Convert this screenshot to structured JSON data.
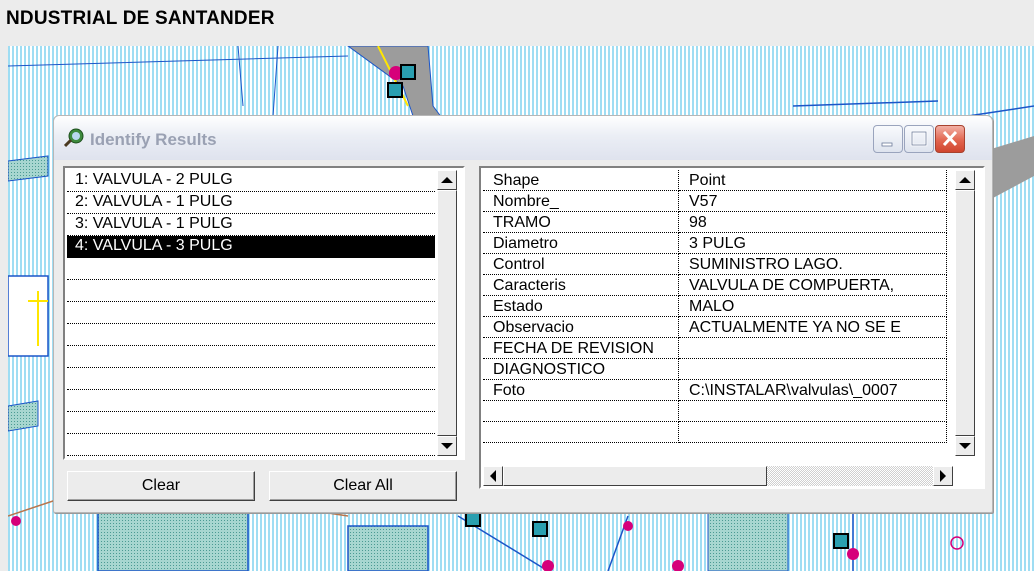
{
  "background": {
    "title": "NDUSTRIAL DE SANTANDER"
  },
  "dialog": {
    "title": "Identify Results",
    "icon": "identify-magnifier-globe-icon",
    "list_items": [
      {
        "label": "1:  VALVULA - 2 PULG",
        "selected": false
      },
      {
        "label": "2:  VALVULA - 1 PULG",
        "selected": false
      },
      {
        "label": "3:  VALVULA - 1 PULG",
        "selected": false
      },
      {
        "label": "4:  VALVULA - 3 PULG",
        "selected": true
      }
    ],
    "attributes": [
      {
        "field": "Shape",
        "value": "Point"
      },
      {
        "field": "Nombre_",
        "value": "V57"
      },
      {
        "field": "TRAMO",
        "value": "98"
      },
      {
        "field": "Diametro",
        "value": "3 PULG"
      },
      {
        "field": "Control",
        "value": "SUMINISTRO LAGO."
      },
      {
        "field": "Caracteris",
        "value": "VALVULA DE COMPUERTA,"
      },
      {
        "field": "Estado",
        "value": "MALO"
      },
      {
        "field": "Observacio",
        "value": "ACTUALMENTE YA NO SE E"
      },
      {
        "field": "FECHA DE REVISION",
        "value": ""
      },
      {
        "field": "DIAGNOSTICO",
        "value": ""
      },
      {
        "field": "Foto",
        "value": "C:\\INSTALAR\\valvulas\\_0007"
      },
      {
        "field": "",
        "value": ""
      },
      {
        "field": "",
        "value": ""
      }
    ],
    "buttons": {
      "clear": "Clear",
      "clear_all": "Clear All"
    }
  }
}
